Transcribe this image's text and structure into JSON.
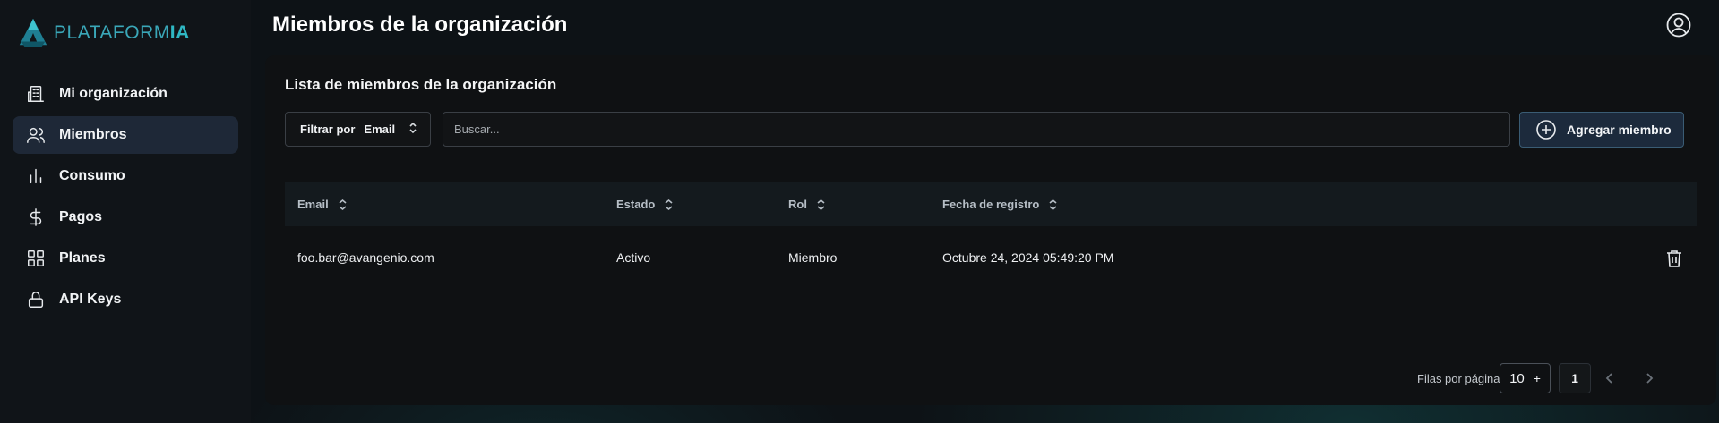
{
  "brand": {
    "name_main": "PLATAFORM",
    "name_accent": "IA"
  },
  "sidebar": {
    "items": [
      {
        "label": "Mi organización",
        "icon": "building-icon",
        "active": false
      },
      {
        "label": "Miembros",
        "icon": "users-icon",
        "active": true
      },
      {
        "label": "Consumo",
        "icon": "bar-chart-icon",
        "active": false
      },
      {
        "label": "Pagos",
        "icon": "dollar-icon",
        "active": false
      },
      {
        "label": "Planes",
        "icon": "grid-icon",
        "active": false
      },
      {
        "label": "API Keys",
        "icon": "lock-icon",
        "active": false
      }
    ]
  },
  "header": {
    "title": "Miembros de la organización"
  },
  "card": {
    "title": "Lista de miembros de la organización",
    "filter": {
      "prefix": "Filtrar por",
      "value": "Email"
    },
    "search": {
      "placeholder": "Buscar...",
      "value": ""
    },
    "add_button": "Agregar miembro"
  },
  "table": {
    "columns": [
      "Email",
      "Estado",
      "Rol",
      "Fecha de registro"
    ],
    "rows": [
      {
        "email": "foo.bar@avangenio.com",
        "estado": "Activo",
        "rol": "Miembro",
        "fecha": "Octubre 24, 2024 05:49:20 PM"
      }
    ]
  },
  "pagination": {
    "rows_label": "Filas por página",
    "rows_value": "10",
    "rows_suffix": "+",
    "current_page": "1"
  },
  "colors": {
    "accent": "#2fb8c4",
    "active_bg": "#1e2837",
    "button_bg": "#1c2a3c"
  }
}
